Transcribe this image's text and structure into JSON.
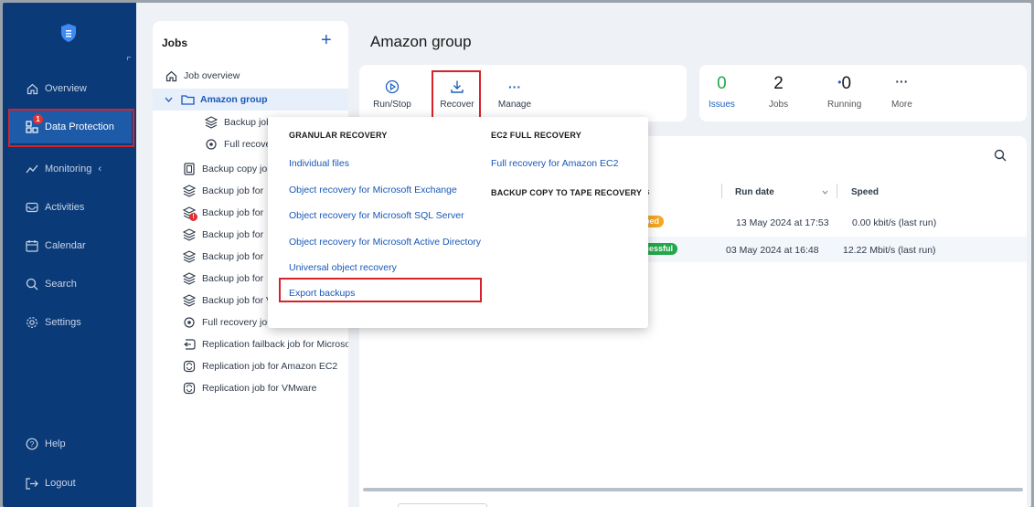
{
  "sidebar": {
    "badge": "1",
    "items": [
      {
        "label": "Overview",
        "icon": "home-icon"
      },
      {
        "label": "Data Protection",
        "icon": "data-protection-icon"
      },
      {
        "label": "Monitoring",
        "icon": "monitoring-icon"
      },
      {
        "label": "Activities",
        "icon": "activities-icon"
      },
      {
        "label": "Calendar",
        "icon": "calendar-icon"
      },
      {
        "label": "Search",
        "icon": "search-icon"
      },
      {
        "label": "Settings",
        "icon": "gear-icon"
      },
      {
        "label": "Help",
        "icon": "help-icon"
      },
      {
        "label": "Logout",
        "icon": "logout-icon"
      }
    ],
    "colors": {
      "background": "#0b3a78",
      "active": "#1d5aa8",
      "highlight": "#d6232a"
    }
  },
  "jobs": {
    "title": "Jobs",
    "overview": "Job overview",
    "group": "Amazon group",
    "children": [
      "Backup job",
      "Full recovery"
    ],
    "items": [
      "Backup copy job",
      "Backup job for",
      "Backup job for",
      "Backup job for",
      "Backup job for",
      "Backup job for",
      "Backup job for VMware Cloud Direc",
      "Full recovery job for VMware Cloud",
      "Replication failback job for Microso",
      "Replication job for Amazon EC2",
      "Replication job for VMware"
    ]
  },
  "main": {
    "title": "Amazon group",
    "toolbar": {
      "run_stop": "Run/Stop",
      "recover": "Recover",
      "manage": "Manage"
    },
    "stats": {
      "issues_value": "0",
      "issues_label": "Issues",
      "jobs_value": "2",
      "jobs_label": "Jobs",
      "running_value": "0",
      "running_label": "Running",
      "more_label": "More"
    },
    "table": {
      "status_header": "s",
      "run_date_header": "Run date",
      "speed_header": "Speed",
      "rows": [
        {
          "status": "ped",
          "status_color": "#f5a623",
          "run_date": "13 May 2024 at 17:53",
          "speed": "0.00 kbit/s (last run)"
        },
        {
          "status": "cessful",
          "status_color": "#22a84a",
          "run_date": "03 May 2024 at 16:48",
          "speed": "12.22 Mbit/s (last run)"
        }
      ]
    }
  },
  "dropdown": {
    "granular_header": "GRANULAR RECOVERY",
    "granular_items": [
      "Individual files",
      "Object recovery for Microsoft Exchange",
      "Object recovery for Microsoft SQL Server",
      "Object recovery for Microsoft Active Directory",
      "Universal object recovery",
      "Export backups"
    ],
    "ec2_header": "EC2 FULL RECOVERY",
    "ec2_items": [
      "Full recovery for Amazon EC2"
    ],
    "tape_header": "BACKUP COPY TO TAPE RECOVERY"
  }
}
